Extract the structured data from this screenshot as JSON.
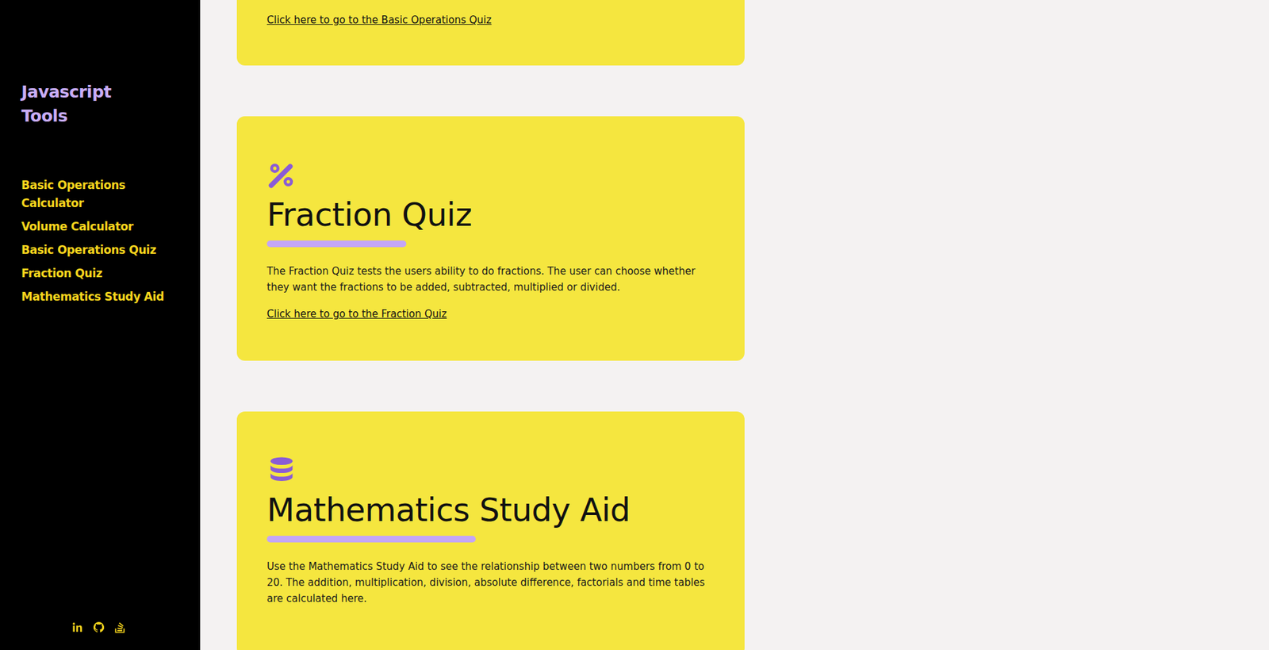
{
  "sidebar": {
    "title": "Javascript Tools",
    "items": [
      {
        "label": "Basic Operations Calculator"
      },
      {
        "label": "Volume Calculator"
      },
      {
        "label": "Basic Operations Quiz"
      },
      {
        "label": "Fraction Quiz"
      },
      {
        "label": "Mathematics Study Aid"
      }
    ]
  },
  "cards": [
    {
      "kind": "cut",
      "link": "Click here to go to the Basic Operations Quiz"
    },
    {
      "kind": "fraction",
      "title": "Fraction Quiz",
      "description": "The Fraction Quiz tests the users ability to do fractions. The user can choose whether they want the fractions to be added, subtracted, multiplied or divided.",
      "link": "Click here to go to the Fraction Quiz"
    },
    {
      "kind": "study",
      "title": "Mathematics Study Aid",
      "description": "Use the Mathematics Study Aid to see the relationship between two numbers from 0 to 20. The addition, multiplication, division, absolute difference, factorials and time tables are calculated here."
    }
  ]
}
